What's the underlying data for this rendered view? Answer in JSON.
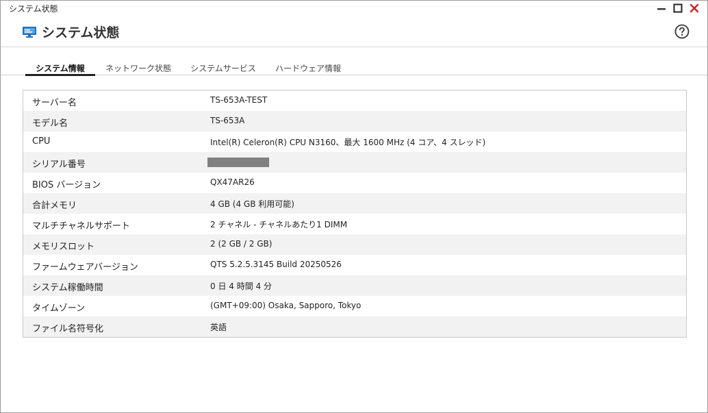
{
  "window": {
    "title": "システム状態"
  },
  "header": {
    "title": "システム状態"
  },
  "tabs": [
    {
      "label": "システム情報",
      "active": true
    },
    {
      "label": "ネットワーク状態",
      "active": false
    },
    {
      "label": "システムサービス",
      "active": false
    },
    {
      "label": "ハードウェア情報",
      "active": false
    }
  ],
  "rows": [
    {
      "label": "サーバー名",
      "value": "TS-653A-TEST"
    },
    {
      "label": "モデル名",
      "value": "TS-653A"
    },
    {
      "label": "CPU",
      "value": "Intel(R) Celeron(R) CPU N3160、最大 1600 MHz (4 コア、4 スレッド)"
    },
    {
      "label": "シリアル番号",
      "value": ""
    },
    {
      "label": "BIOS バージョン",
      "value": "QX47AR26"
    },
    {
      "label": "合計メモリ",
      "value": "4 GB (4 GB 利用可能)"
    },
    {
      "label": "マルチチャネルサポート",
      "value": "2 チャネル - チャネルあたり1 DIMM"
    },
    {
      "label": "メモリスロット",
      "value": "2 (2 GB / 2 GB)"
    },
    {
      "label": "ファームウェアバージョン",
      "value": "QTS 5.2.5.3145 Build 20250526"
    },
    {
      "label": "システム稼働時間",
      "value": "0 日 4 時間 4 分"
    },
    {
      "label": "タイムゾーン",
      "value": "(GMT+09:00) Osaka, Sapporo, Tokyo"
    },
    {
      "label": "ファイル名符号化",
      "value": "英語"
    }
  ],
  "colors": {
    "accent": "#1e6fb8",
    "close": "#d32020",
    "row_alt": "#f2f2f2"
  },
  "icons": {
    "app": "monitor-icon",
    "help": "help-icon",
    "minimize": "minimize-icon",
    "maximize": "maximize-icon",
    "close": "close-icon"
  }
}
